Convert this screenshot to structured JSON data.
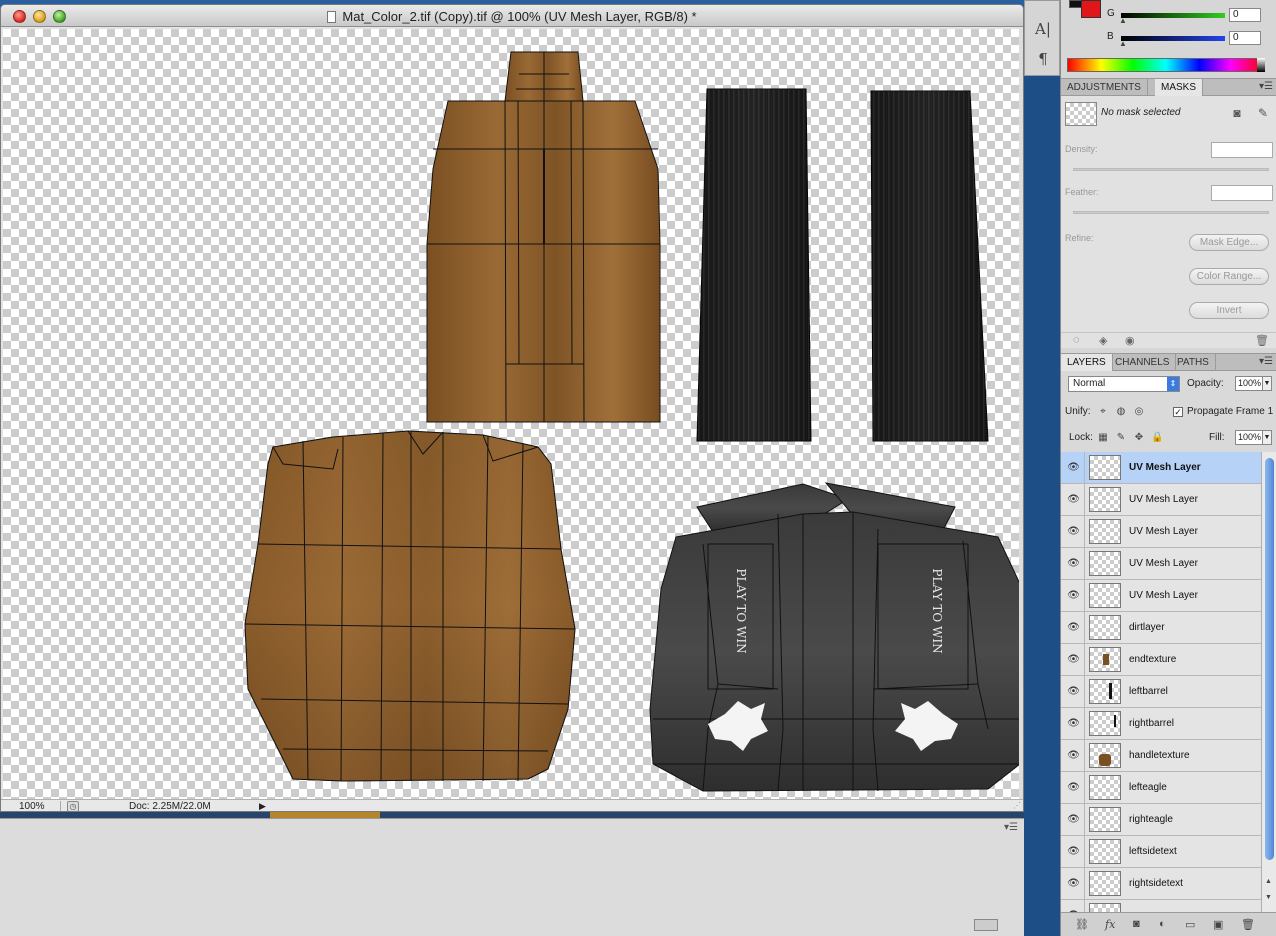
{
  "document": {
    "title": "Mat_Color_2.tif (Copy).tif @ 100% (UV Mesh Layer, RGB/8) *",
    "zoom": "100%",
    "doc_size": "Doc: 2.25M/22.0M"
  },
  "tools": [
    {
      "icon": "text-tool-icon",
      "glyph": "A|"
    },
    {
      "icon": "paragraph-icon",
      "glyph": "¶"
    }
  ],
  "color_panel": {
    "g_label": "G",
    "g_value": "0",
    "b_label": "B",
    "b_value": "0",
    "colors": {
      "foreground": "#111111",
      "background": "#e0161b"
    }
  },
  "masks_panel": {
    "tabs": [
      "ADJUSTMENTS",
      "MASKS"
    ],
    "active_tab": "MASKS",
    "no_mask": "No mask selected",
    "density_label": "Density:",
    "feather_label": "Feather:",
    "refine_label": "Refine:",
    "mask_edge_button": "Mask Edge...",
    "color_range_button": "Color Range...",
    "invert_button": "Invert"
  },
  "layers_panel": {
    "tabs": [
      "LAYERS",
      "CHANNELS",
      "PATHS"
    ],
    "active_tab": "LAYERS",
    "blend_mode": "Normal",
    "opacity_label": "Opacity:",
    "opacity": "100%",
    "unify_label": "Unify:",
    "propagate_label": "Propagate Frame 1",
    "lock_label": "Lock:",
    "fill_label": "Fill:",
    "fill": "100%",
    "layers": [
      {
        "name": "UV Mesh Layer",
        "selected": true
      },
      {
        "name": "UV Mesh Layer"
      },
      {
        "name": "UV Mesh Layer"
      },
      {
        "name": "UV Mesh Layer"
      },
      {
        "name": "UV Mesh Layer"
      },
      {
        "name": "dirtlayer"
      },
      {
        "name": "endtexture"
      },
      {
        "name": "leftbarrel"
      },
      {
        "name": "rightbarrel"
      },
      {
        "name": "handletexture"
      },
      {
        "name": "lefteagle"
      },
      {
        "name": "righteagle"
      },
      {
        "name": "leftsidetext"
      },
      {
        "name": "rightsidetext"
      }
    ]
  },
  "canvas_text": {
    "side_text_left": "PLAY TO WIN",
    "side_text_right": "PLAY TO WIN"
  }
}
